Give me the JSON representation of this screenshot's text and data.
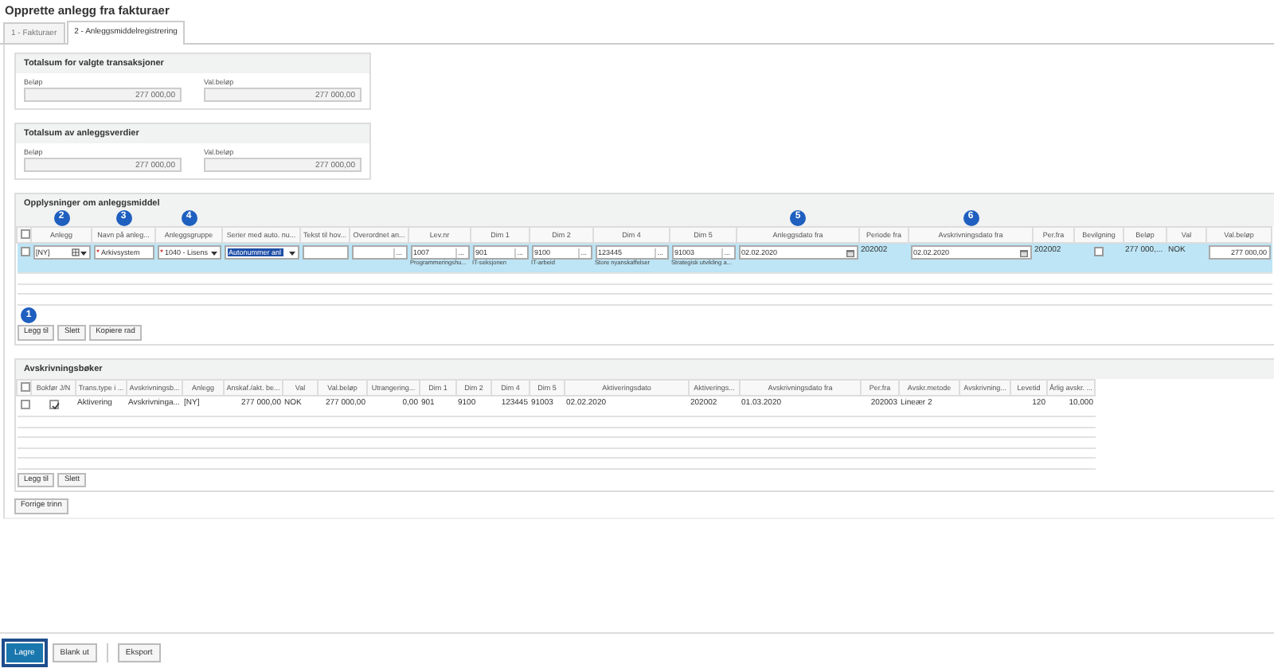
{
  "title": "Opprette anlegg fra fakturaer",
  "tabs": [
    {
      "label": "1 - Fakturaer",
      "selected": false
    },
    {
      "label": "2 - Anleggsmiddelregistrering",
      "selected": true
    }
  ],
  "sums": [
    {
      "title": "Totalsum for valgte transaksjoner",
      "fields": [
        {
          "label": "Beløp",
          "value": "277 000,00"
        },
        {
          "label": "Val.beløp",
          "value": "277 000,00"
        }
      ]
    },
    {
      "title": "Totalsum av anleggsverdier",
      "fields": [
        {
          "label": "Beløp",
          "value": "277 000,00"
        },
        {
          "label": "Val.beløp",
          "value": "277 000,00"
        }
      ]
    }
  ],
  "asset": {
    "title": "Opplysninger om anleggsmiddel",
    "columns": [
      "",
      "Anlegg",
      "Navn på anleg...",
      "Anleggsgruppe",
      "Serier med auto. nu...",
      "Tekst til hov...",
      "Overordnet an...",
      "Lev.nr",
      "Dim 1",
      "Dim 2",
      "Dim 4",
      "Dim 5",
      "Anleggsdato fra",
      "Periode fra",
      "Avskrivningsdato fra",
      "Per.fra",
      "Bevilgning",
      "Beløp",
      "Val",
      "Val.beløp"
    ],
    "row": [
      {
        "kind": "checkbox",
        "checked": false
      },
      {
        "kind": "menu",
        "value": "[NY]"
      },
      {
        "kind": "input",
        "value": "Arkivsystem",
        "required_mark": "*"
      },
      {
        "kind": "select",
        "value": "1040 - Lisens",
        "required_mark": "*"
      },
      {
        "kind": "select",
        "value": "Autonummer anl",
        "highlighted": true
      },
      {
        "kind": "input"
      },
      {
        "kind": "lookup",
        "button": "..."
      },
      {
        "kind": "lookup",
        "value": "1007",
        "button": "...",
        "sub": "Programmeringshu..."
      },
      {
        "kind": "lookup",
        "value": "901",
        "button": "...",
        "sub": "IT-seksjonen"
      },
      {
        "kind": "lookup",
        "value": "9100",
        "button": "...",
        "sub": "IT-arbeid"
      },
      {
        "kind": "lookup",
        "value": "123445",
        "button": "...",
        "sub": "Store nyanskaffelser"
      },
      {
        "kind": "lookup",
        "value": "91003",
        "button": "...",
        "sub": "Strategisk utvikling a..."
      },
      {
        "kind": "date",
        "value": "02.02.2020"
      },
      {
        "kind": "text",
        "value": "202002"
      },
      {
        "kind": "date",
        "value": "02.02.2020"
      },
      {
        "kind": "text",
        "value": "202002"
      },
      {
        "kind": "checkbox",
        "checked": false
      },
      {
        "kind": "text",
        "value": "277 000,..."
      },
      {
        "kind": "text",
        "value": "NOK"
      },
      {
        "kind": "amount",
        "value": "277 000,00"
      }
    ],
    "header_checked": false,
    "buttons": [
      "Legg til",
      "Slett",
      "Kopiere rad"
    ]
  },
  "markers": [
    "1",
    "2",
    "3",
    "4",
    "5",
    "6"
  ],
  "books": {
    "title": "Avskrivningsbøker",
    "columns": [
      "",
      "Bokfør J/N",
      "Trans.type i ...",
      "Avskrivningsb...",
      "Anlegg",
      "Anskaf./akt. be...",
      "Val",
      "Val.beløp",
      "Utrangering...",
      "Dim 1",
      "Dim 2",
      "Dim 4",
      "Dim 5",
      "Aktiveringsdato",
      "Aktiverings...",
      "Avskrivningsdato fra",
      "Per.fra",
      "Avskr.metode",
      "Avskrivning...",
      "Levetid",
      "Årlig avskr. ..."
    ],
    "row": [
      {
        "kind": "checkbox",
        "checked": false
      },
      {
        "kind": "checkbox",
        "checked": true
      },
      {
        "kind": "text",
        "value": "Aktivering"
      },
      {
        "kind": "text",
        "value": "Avskrivninga..."
      },
      {
        "kind": "text",
        "value": "[NY]"
      },
      {
        "kind": "number",
        "value": "277 000,00"
      },
      {
        "kind": "text",
        "value": "NOK"
      },
      {
        "kind": "number",
        "value": "277 000,00"
      },
      {
        "kind": "number",
        "value": "0,00"
      },
      {
        "kind": "text",
        "value": "901"
      },
      {
        "kind": "text",
        "value": "9100"
      },
      {
        "kind": "number",
        "value": "123445"
      },
      {
        "kind": "text",
        "value": "91003"
      },
      {
        "kind": "text",
        "value": "02.02.2020"
      },
      {
        "kind": "text",
        "value": "202002"
      },
      {
        "kind": "text",
        "value": "01.03.2020"
      },
      {
        "kind": "number",
        "value": "202003"
      },
      {
        "kind": "text",
        "value": "Lineær 2"
      },
      {
        "kind": "text"
      },
      {
        "kind": "number",
        "value": "120"
      },
      {
        "kind": "number",
        "value": "10,000"
      }
    ],
    "header_checked": false,
    "buttons": [
      "Legg til",
      "Slett"
    ]
  },
  "back_button": "Forrige trinn",
  "footer": [
    {
      "label": "Lagre",
      "kind": "primary"
    },
    {
      "label": "Blank ut",
      "kind": "default"
    },
    {
      "label": "Eksport",
      "kind": "default"
    }
  ]
}
